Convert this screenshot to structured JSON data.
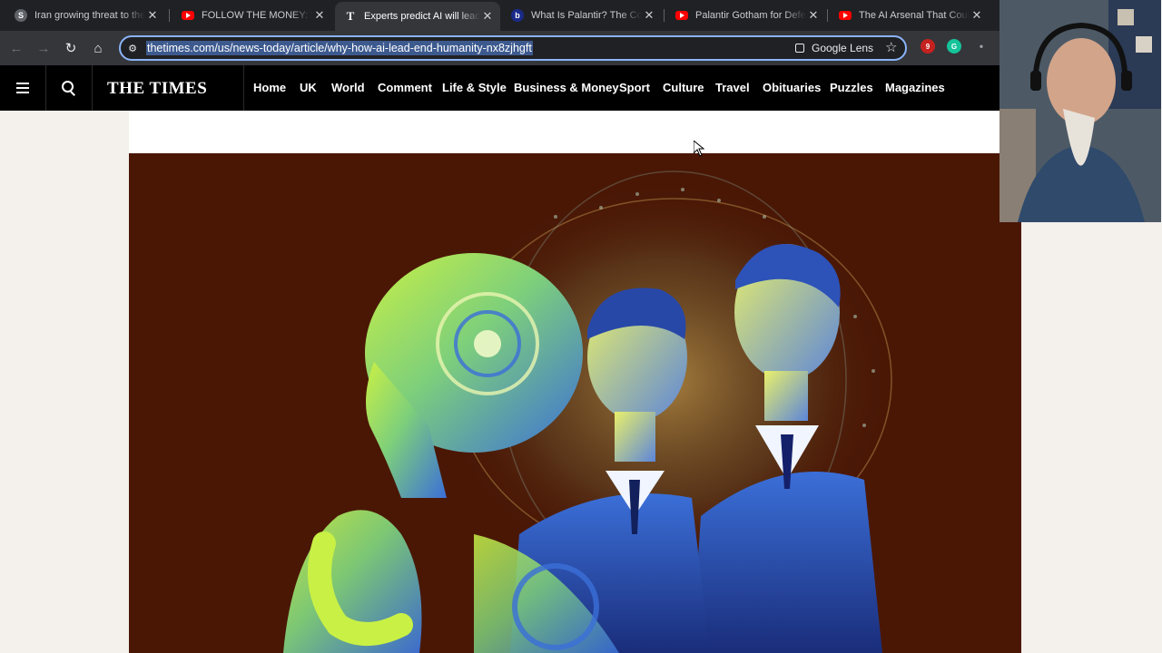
{
  "browser": {
    "tabs": [
      {
        "title": "Iran growing threat to the W",
        "favicon": "s-icon",
        "active": false
      },
      {
        "title": "FOLLOW THE MONEY: Epstei",
        "favicon": "youtube-icon",
        "active": false
      },
      {
        "title": "Experts predict AI will lead t",
        "favicon": "times-t-icon",
        "active": true
      },
      {
        "title": "What Is Palantir? The Comp",
        "favicon": "b-icon",
        "active": false
      },
      {
        "title": "Palantir Gotham for Defens",
        "favicon": "youtube-icon",
        "active": false
      },
      {
        "title": "The AI Arsenal That Could S",
        "favicon": "youtube-icon",
        "active": false
      }
    ],
    "url": "thetimes.com/us/news-today/article/why-how-ai-lead-end-humanity-nx8zjhgft",
    "lens_label": "Google Lens",
    "extension_badge": "9"
  },
  "site": {
    "logo": "THE TIMES",
    "menu": [
      "Home",
      "UK",
      "World",
      "Comment",
      "Life & Style",
      "Business & Money",
      "Sport",
      "Culture",
      "Travel",
      "Obituaries",
      "Puzzles",
      "Magazines"
    ]
  },
  "colors": {
    "hero_background": "#4a1705",
    "highlight": "#c9f045",
    "accent_blue": "#3b6fd8"
  }
}
